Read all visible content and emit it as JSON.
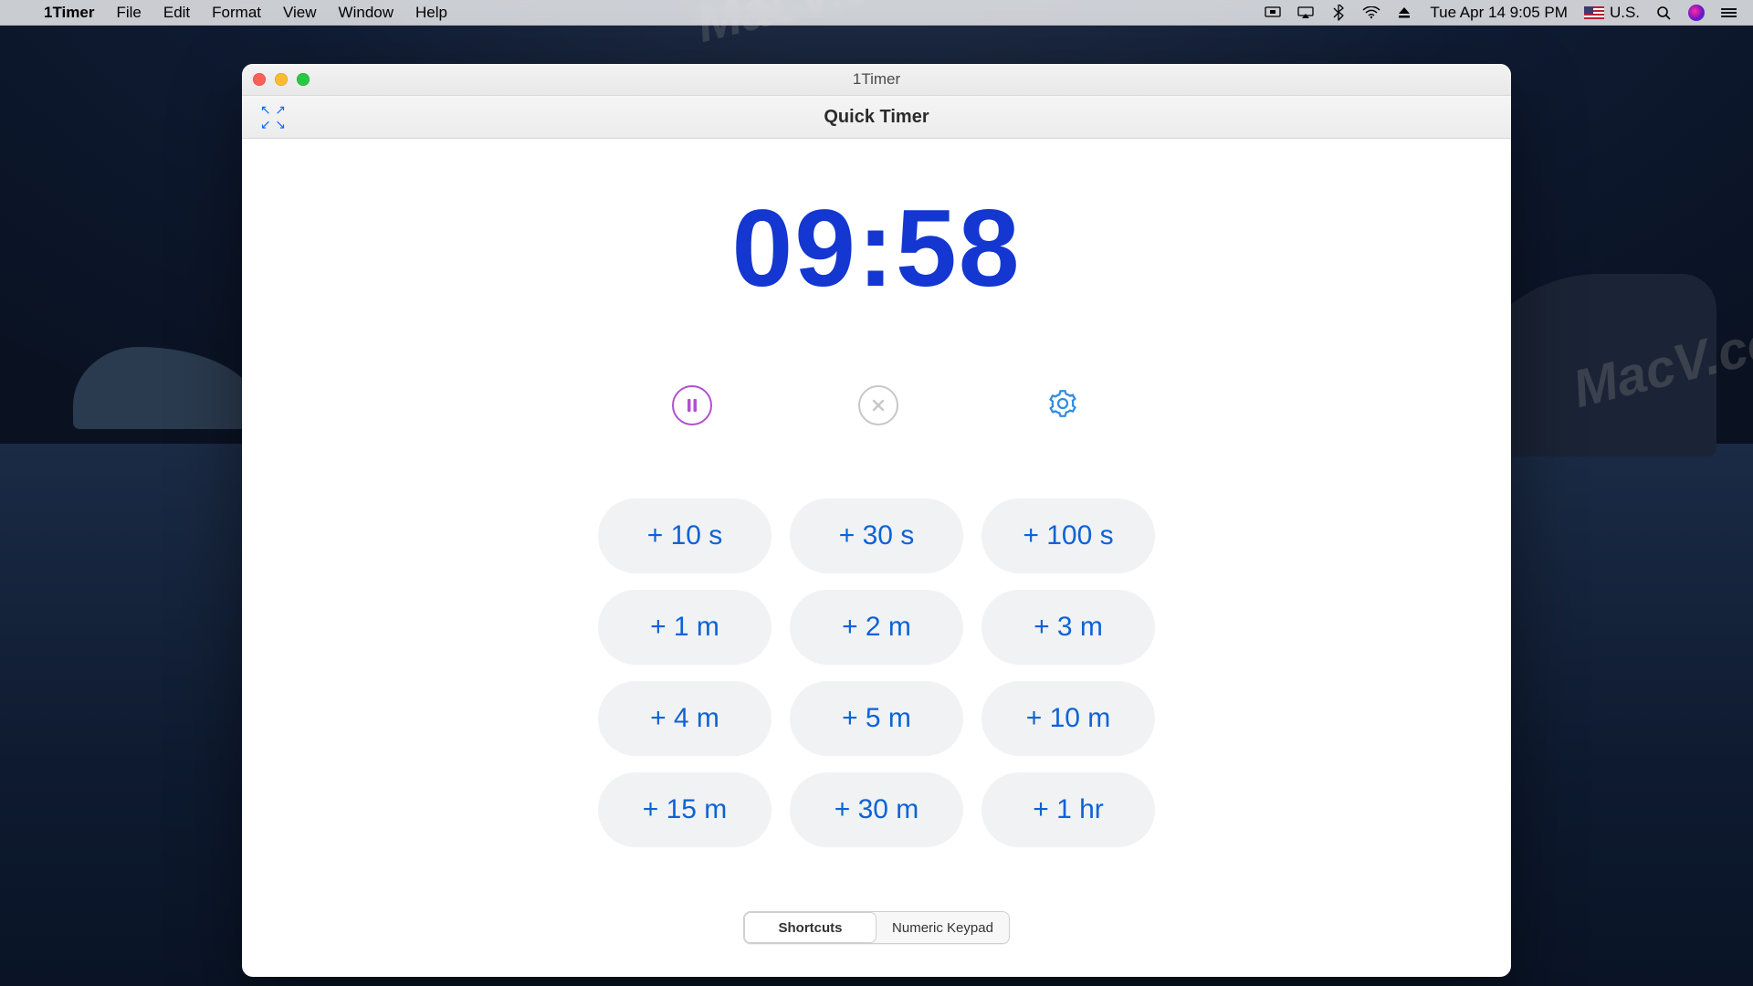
{
  "menubar": {
    "app_name": "1Timer",
    "items": [
      "File",
      "Edit",
      "Format",
      "View",
      "Window",
      "Help"
    ],
    "right": {
      "input_locale": "U.S.",
      "clock": "Tue Apr 14  9:05 PM"
    }
  },
  "watermark": "MacV.com",
  "window": {
    "title": "1Timer",
    "subtitle": "Quick Timer"
  },
  "timer": {
    "display": "09:58"
  },
  "controls": {
    "pause_label": "Pause",
    "cancel_label": "Cancel",
    "settings_label": "Settings"
  },
  "quick_add": [
    "+ 10 s",
    "+ 30 s",
    "+ 100 s",
    "+ 1 m",
    "+ 2 m",
    "+ 3 m",
    "+ 4 m",
    "+ 5 m",
    "+ 10 m",
    "+ 15 m",
    "+ 30 m",
    "+ 1 hr"
  ],
  "mode_tabs": {
    "shortcuts": "Shortcuts",
    "keypad": "Numeric Keypad",
    "active": "shortcuts"
  },
  "colors": {
    "timer": "#1437d1",
    "pill_text": "#0b63d6",
    "pill_bg": "#f1f2f4",
    "pause_ring": "#b24fd0",
    "gear": "#2f8de4"
  }
}
